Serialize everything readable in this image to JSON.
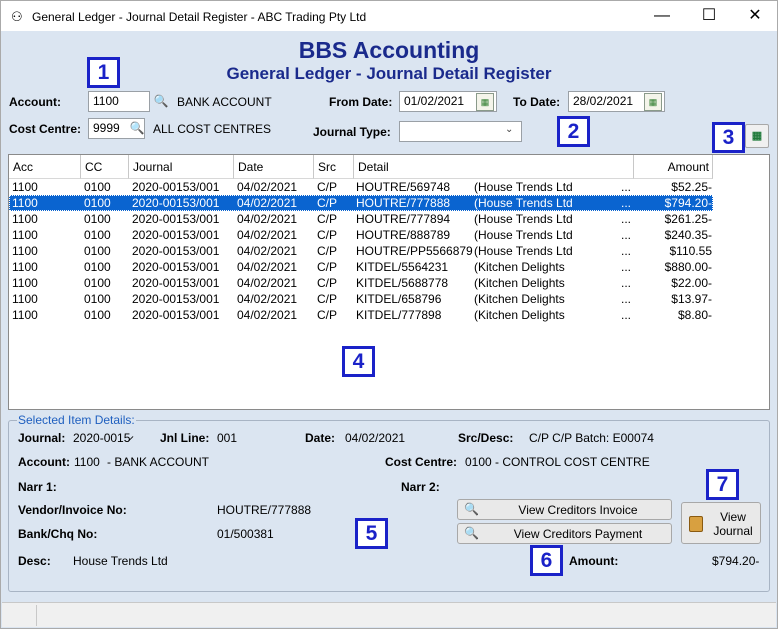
{
  "window": {
    "title": "General Ledger - Journal Detail Register - ABC Trading Pty Ltd",
    "minimize": "—",
    "maximize": "☐",
    "close": "✕"
  },
  "header": {
    "company": "BBS Accounting",
    "report": "General Ledger - Journal Detail Register"
  },
  "filters": {
    "account_label": "Account:",
    "account_value": "1100",
    "account_name": "BANK ACCOUNT",
    "cost_centre_label": "Cost Centre:",
    "cost_centre_value": "9999",
    "cost_centre_name": "ALL COST CENTRES",
    "from_date_label": "From Date:",
    "from_date_value": "01/02/2021",
    "to_date_label": "To Date:",
    "to_date_value": "28/02/2021",
    "journal_type_label": "Journal Type:",
    "journal_type_value": ""
  },
  "badges": [
    "1",
    "2",
    "3",
    "4",
    "5",
    "6",
    "7"
  ],
  "grid": {
    "columns": [
      "Acc",
      "CC",
      "Journal",
      "Date",
      "Src",
      "Detail",
      "Amount"
    ],
    "rows": [
      {
        "acc": "1100",
        "cc": "0100",
        "journal": "2020-00153/001",
        "date": "04/02/2021",
        "src": "C/P",
        "detail": "HOUTRE/569748",
        "desc": "(House Trends Ltd",
        "more": "...",
        "amount": "$52.25-",
        "selected": false
      },
      {
        "acc": "1100",
        "cc": "0100",
        "journal": "2020-00153/001",
        "date": "04/02/2021",
        "src": "C/P",
        "detail": "HOUTRE/777888",
        "desc": "(House Trends Ltd",
        "more": "...",
        "amount": "$794.20-",
        "selected": true
      },
      {
        "acc": "1100",
        "cc": "0100",
        "journal": "2020-00153/001",
        "date": "04/02/2021",
        "src": "C/P",
        "detail": "HOUTRE/777894",
        "desc": "(House Trends Ltd",
        "more": "...",
        "amount": "$261.25-",
        "selected": false
      },
      {
        "acc": "1100",
        "cc": "0100",
        "journal": "2020-00153/001",
        "date": "04/02/2021",
        "src": "C/P",
        "detail": "HOUTRE/888789",
        "desc": "(House Trends Ltd",
        "more": "...",
        "amount": "$240.35-",
        "selected": false
      },
      {
        "acc": "1100",
        "cc": "0100",
        "journal": "2020-00153/001",
        "date": "04/02/2021",
        "src": "C/P",
        "detail": "HOUTRE/PP5566879",
        "desc": "(House Trends Ltd",
        "more": "...",
        "amount": "$110.55",
        "selected": false
      },
      {
        "acc": "1100",
        "cc": "0100",
        "journal": "2020-00153/001",
        "date": "04/02/2021",
        "src": "C/P",
        "detail": "KITDEL/5564231",
        "desc": "(Kitchen Delights",
        "more": "...",
        "amount": "$880.00-",
        "selected": false
      },
      {
        "acc": "1100",
        "cc": "0100",
        "journal": "2020-00153/001",
        "date": "04/02/2021",
        "src": "C/P",
        "detail": "KITDEL/5688778",
        "desc": "(Kitchen Delights",
        "more": "...",
        "amount": "$22.00-",
        "selected": false
      },
      {
        "acc": "1100",
        "cc": "0100",
        "journal": "2020-00153/001",
        "date": "04/02/2021",
        "src": "C/P",
        "detail": "KITDEL/658796",
        "desc": "(Kitchen Delights",
        "more": "...",
        "amount": "$13.97-",
        "selected": false
      },
      {
        "acc": "1100",
        "cc": "0100",
        "journal": "2020-00153/001",
        "date": "04/02/2021",
        "src": "C/P",
        "detail": "KITDEL/777898",
        "desc": "(Kitchen Delights",
        "more": "...",
        "amount": "$8.80-",
        "selected": false
      }
    ]
  },
  "details": {
    "title": "Selected Item Details:",
    "journal_label": "Journal:",
    "journal_value": "2020-0015̷",
    "jnl_line_label": "Jnl Line:",
    "jnl_line_value": "001",
    "date_label": "Date:",
    "date_value": "04/02/2021",
    "src_desc_label": "Src/Desc:",
    "src_desc_value": "C/P C/P Batch: E00074",
    "account_label": "Account:",
    "account_value": "1100",
    "account_name": "- BANK ACCOUNT",
    "cost_centre_label": "Cost Centre:",
    "cost_centre_value": "0100 - CONTROL COST CENTRE",
    "narr1_label": "Narr 1:",
    "narr2_label": "Narr 2:",
    "vendor_label": "Vendor/Invoice No:",
    "vendor_value": "HOUTRE/777888",
    "bank_label": "Bank/Chq No:",
    "bank_value": "01/500381",
    "desc_label": "Desc:",
    "desc_value": "House Trends Ltd",
    "amount_label": "Amount:",
    "amount_value": "$794.20-"
  },
  "buttons": {
    "view_invoice": "View Creditors Invoice",
    "view_payment": "View Creditors Payment",
    "view_journal_1": "View",
    "view_journal_2": "Journal"
  }
}
